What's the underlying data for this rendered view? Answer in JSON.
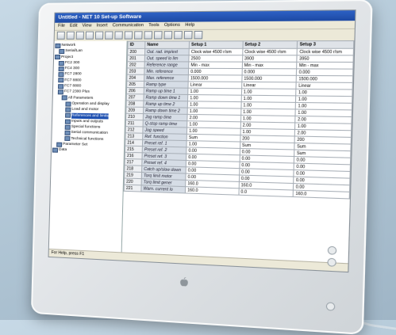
{
  "window": {
    "title": "Untitled - NET 10 Set-up Software"
  },
  "menu": [
    "File",
    "Edit",
    "View",
    "Insert",
    "Communication",
    "Tools",
    "Options",
    "Help"
  ],
  "toolbar_icons": [
    "new-icon",
    "open-icon",
    "save-icon",
    "print-icon",
    "cut-icon",
    "copy-icon",
    "paste-icon",
    "undo-icon",
    "connect-icon",
    "download-icon",
    "upload-icon",
    "help-icon",
    "stop-icon",
    "monitor-icon",
    "settings-icon"
  ],
  "tree": [
    {
      "label": "Network",
      "level": 0
    },
    {
      "label": "Serial/Lan",
      "level": 1
    },
    {
      "label": "Project",
      "level": 0
    },
    {
      "label": "FC2 300",
      "level": 1
    },
    {
      "label": "FC4 300",
      "level": 1
    },
    {
      "label": "FC7 2800",
      "level": 1
    },
    {
      "label": "FC7 8800",
      "level": 1
    },
    {
      "label": "FC7 8800",
      "level": 1
    },
    {
      "label": "FC7 2300 Plus",
      "level": 1
    },
    {
      "label": "All Parameters",
      "level": 2
    },
    {
      "label": "Operation and display",
      "level": 3
    },
    {
      "label": "Load and motor",
      "level": 3
    },
    {
      "label": "References and limits",
      "level": 3,
      "selected": true
    },
    {
      "label": "Inputs and outputs",
      "level": 3
    },
    {
      "label": "Special functions",
      "level": 3
    },
    {
      "label": "Serial communication",
      "level": 3
    },
    {
      "label": "Technical functions",
      "level": 3
    },
    {
      "label": "Parameter Set",
      "level": 1
    },
    {
      "label": "Data",
      "level": 0
    }
  ],
  "table": {
    "headers": [
      "ID",
      "Name",
      "Setup 1",
      "Setup 2",
      "Setup 3"
    ],
    "rows": [
      [
        "200",
        "Out. rad. imp/ext",
        "Clock wise 4500 r/sm",
        "Clock wise 4500 r/sm",
        "Clock wise 4500 r/sm"
      ],
      [
        "201",
        "Out. speed lo lim",
        "2500",
        "3900",
        "3950"
      ],
      [
        "202",
        "Reference range",
        "Min - max",
        "Min - max",
        "Min - max"
      ],
      [
        "203",
        "Min. reference",
        "0.000",
        "0.000",
        "0.000"
      ],
      [
        "204",
        "Max. reference",
        "1500.000",
        "1500.000",
        "1500.000"
      ],
      [
        "205",
        "Ramp type",
        "Linear",
        "Linear",
        "Linear"
      ],
      [
        "206",
        "Ramp up time 1",
        "1.00",
        "1.00",
        "1.00"
      ],
      [
        "207",
        "Ramp down time 1",
        "1.00",
        "1.00",
        "1.00"
      ],
      [
        "208",
        "Ramp up time 2",
        "1.00",
        "1.00",
        "1.00"
      ],
      [
        "209",
        "Ramp down time 2",
        "1.00",
        "1.00",
        "1.00"
      ],
      [
        "210",
        "Jog ramp time",
        "2.00",
        "1.00",
        "2.00"
      ],
      [
        "211",
        "Q-stop ramp time",
        "1.00",
        "2.00",
        "1.00"
      ],
      [
        "212",
        "Jog speed",
        "1.00",
        "1.00",
        "2.00"
      ],
      [
        "213",
        "Ref. function",
        "Sum",
        "200",
        "200"
      ],
      [
        "214",
        "Preset ref. 1",
        "1.00",
        "Sum",
        "Sum"
      ],
      [
        "215",
        "Preset ref. 2",
        "0.00",
        "0.00",
        "Sum"
      ],
      [
        "216",
        "Preset ref. 3",
        "0.00",
        "0.00",
        "0.00"
      ],
      [
        "217",
        "Preset ref. 4",
        "0.00",
        "0.00",
        "0.00"
      ],
      [
        "218",
        "Catch up/slow down",
        "0.00",
        "0.00",
        "0.00"
      ],
      [
        "219",
        "Torq limit motor",
        "0.00",
        "0.00",
        "0.00"
      ],
      [
        "220",
        "Torq limit gener",
        "160.0",
        "160.0",
        "0.00"
      ],
      [
        "221",
        "Warn. current lo",
        "160.0",
        "0.0",
        "160.0"
      ]
    ]
  },
  "status": "For Help, press F1"
}
